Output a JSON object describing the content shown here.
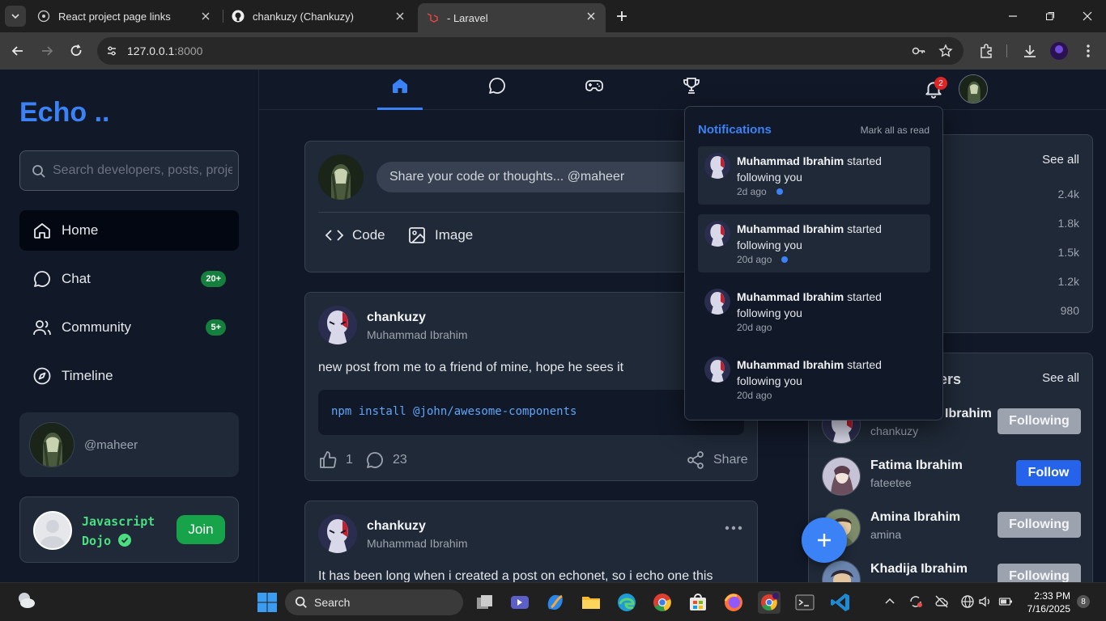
{
  "browser": {
    "tabs": [
      {
        "title": "React project page links"
      },
      {
        "title": "chankuzy (Chankuzy)"
      },
      {
        "title": "- Laravel"
      }
    ],
    "url_host": "127.0.0.1",
    "url_port": ":8000"
  },
  "sidebar": {
    "logo": "Echo ..",
    "search_placeholder": "Search developers, posts, projects",
    "items": [
      {
        "label": "Home",
        "icon": "home-icon",
        "badge": ""
      },
      {
        "label": "Chat",
        "icon": "chat-icon",
        "badge": "20+"
      },
      {
        "label": "Community",
        "icon": "users-icon",
        "badge": "5+"
      },
      {
        "label": "Timeline",
        "icon": "compass-icon",
        "badge": ""
      }
    ],
    "me_handle": "@maheer",
    "community": {
      "name": "Javascript Dojo",
      "join_label": "Join"
    }
  },
  "topnav": {
    "notification_count": "2"
  },
  "composer": {
    "placeholder": "Share your code or thoughts... @maheer",
    "code_label": "Code",
    "image_label": "Image"
  },
  "posts": [
    {
      "username": "chankuzy",
      "fullname": "Muhammad Ibrahim",
      "body": "new post from me to a friend of mine, hope he sees it",
      "code": "npm install @john/awesome-components",
      "likes": "1",
      "comments": "23",
      "share_label": "Share"
    },
    {
      "username": "chankuzy",
      "fullname": "Muhammad Ibrahim",
      "body": "It has been long when i created a post on echonet, so i echo one this"
    }
  ],
  "trending": {
    "see_all": "See all",
    "counts": [
      "2.4k",
      "1.8k",
      "1.5k",
      "1.2k",
      "980"
    ]
  },
  "developers": {
    "title": "pers",
    "see_all": "See all",
    "list": [
      {
        "name": "Ibrahim",
        "handle": "chankuzy",
        "button": "Following"
      },
      {
        "name": "Fatima Ibrahim",
        "handle": "fateetee",
        "button": "Follow"
      },
      {
        "name": "Amina Ibrahim",
        "handle": "amina",
        "button": "Following"
      },
      {
        "name": "Khadija Ibrahim",
        "handle": "",
        "button": "Following"
      }
    ]
  },
  "notifications": {
    "title": "Notifications",
    "mark_all": "Mark all as read",
    "items": [
      {
        "name": "Muhammad Ibrahim",
        "text": " started following you",
        "time": "2d ago",
        "unread": true
      },
      {
        "name": "Muhammad Ibrahim",
        "text": " started following you",
        "time": "20d ago",
        "unread": true
      },
      {
        "name": "Muhammad Ibrahim",
        "text": " started following you",
        "time": "20d ago",
        "unread": false
      },
      {
        "name": "Muhammad Ibrahim",
        "text": " started following you",
        "time": "20d ago",
        "unread": false
      }
    ]
  },
  "taskbar": {
    "search_label": "Search",
    "time": "2:33 PM",
    "date": "7/16/2025",
    "notif_count": "8"
  },
  "colors": {
    "accent": "#3b82f6",
    "green": "#16a34a",
    "bg": "#111827",
    "card": "#1f2937"
  }
}
